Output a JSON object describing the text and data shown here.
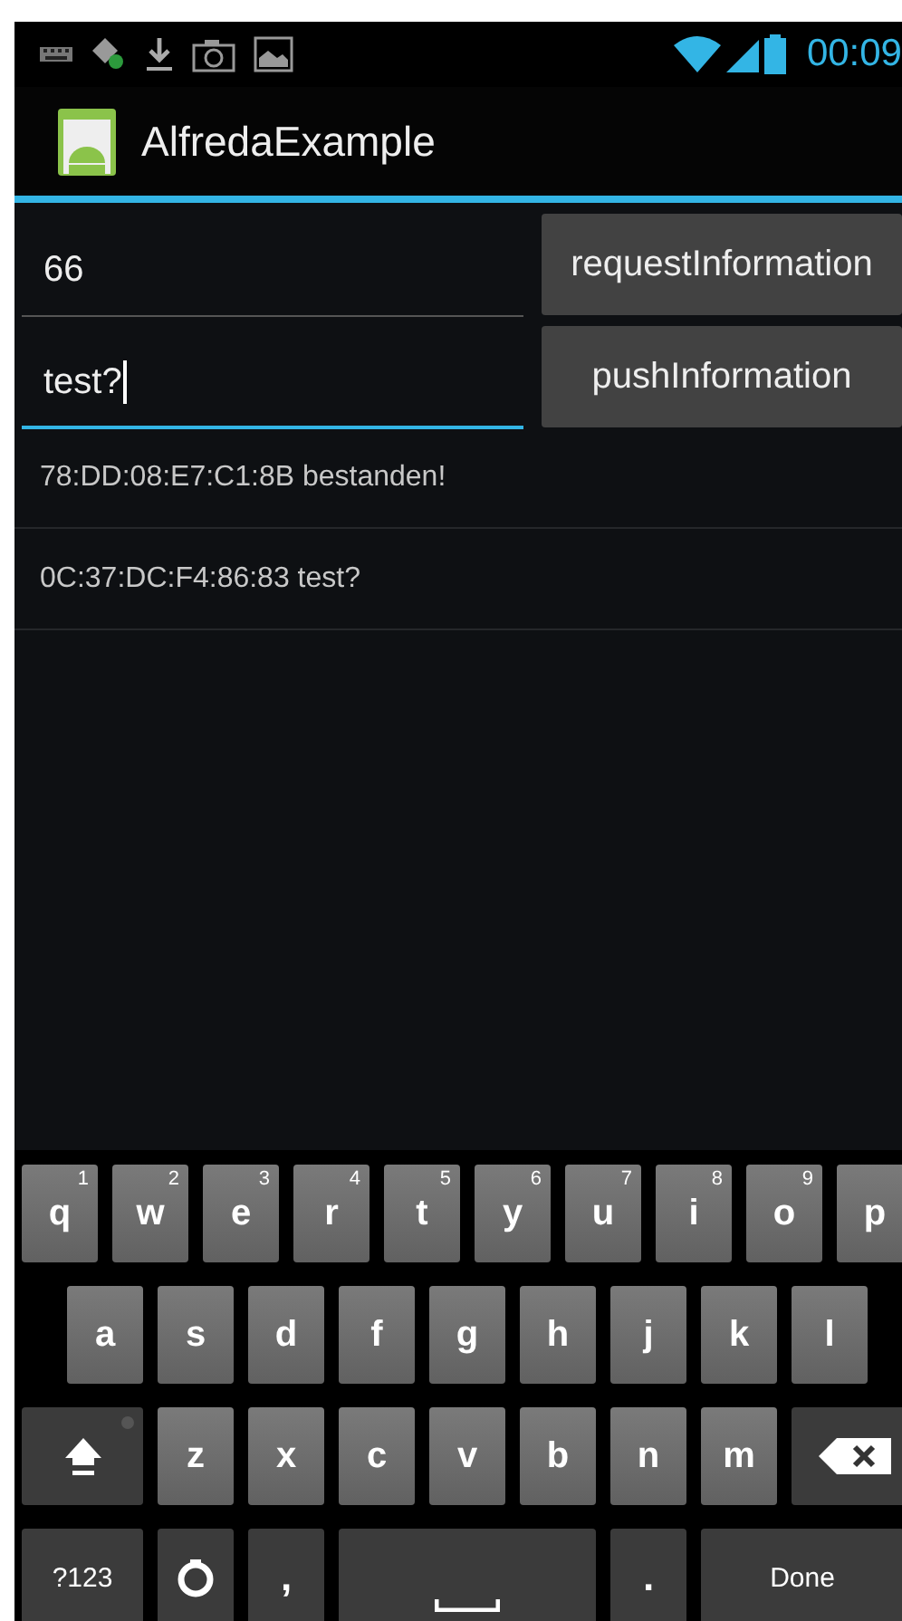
{
  "status_bar": {
    "time": "00:09"
  },
  "action_bar": {
    "title": "AlfredaExample"
  },
  "form": [
    {
      "field": {
        "value": "66",
        "focused": false
      },
      "button": "requestInformation"
    },
    {
      "field": {
        "value": "test?",
        "focused": true
      },
      "button": "pushInformation"
    }
  ],
  "messages": [
    "78:DD:08:E7:C1:8B bestanden!",
    "0C:37:DC:F4:86:83 test?"
  ],
  "keyboard": {
    "rows": [
      {
        "keys": [
          {
            "kind": "letter",
            "label": "q",
            "hint": "1"
          },
          {
            "kind": "letter",
            "label": "w",
            "hint": "2"
          },
          {
            "kind": "letter",
            "label": "e",
            "hint": "3"
          },
          {
            "kind": "letter",
            "label": "r",
            "hint": "4"
          },
          {
            "kind": "letter",
            "label": "t",
            "hint": "5"
          },
          {
            "kind": "letter",
            "label": "y",
            "hint": "6"
          },
          {
            "kind": "letter",
            "label": "u",
            "hint": "7"
          },
          {
            "kind": "letter",
            "label": "i",
            "hint": "8"
          },
          {
            "kind": "letter",
            "label": "o",
            "hint": "9"
          },
          {
            "kind": "letter",
            "label": "p"
          }
        ]
      },
      {
        "keys": [
          {
            "kind": "letter",
            "label": "a"
          },
          {
            "kind": "letter",
            "label": "s"
          },
          {
            "kind": "letter",
            "label": "d"
          },
          {
            "kind": "letter",
            "label": "f"
          },
          {
            "kind": "letter",
            "label": "g"
          },
          {
            "kind": "letter",
            "label": "h"
          },
          {
            "kind": "letter",
            "label": "j"
          },
          {
            "kind": "letter",
            "label": "k"
          },
          {
            "kind": "letter",
            "label": "l"
          }
        ]
      },
      {
        "keys": [
          {
            "kind": "shift"
          },
          {
            "kind": "letter",
            "label": "z"
          },
          {
            "kind": "letter",
            "label": "x"
          },
          {
            "kind": "letter",
            "label": "c"
          },
          {
            "kind": "letter",
            "label": "v"
          },
          {
            "kind": "letter",
            "label": "b"
          },
          {
            "kind": "letter",
            "label": "n"
          },
          {
            "kind": "letter",
            "label": "m"
          },
          {
            "kind": "backspace"
          }
        ]
      },
      {
        "keys": [
          {
            "kind": "symbols",
            "label": "?123"
          },
          {
            "kind": "settings"
          },
          {
            "kind": "punct",
            "label": ","
          },
          {
            "kind": "space"
          },
          {
            "kind": "punct",
            "label": "."
          },
          {
            "kind": "done",
            "label": "Done"
          }
        ]
      }
    ]
  }
}
